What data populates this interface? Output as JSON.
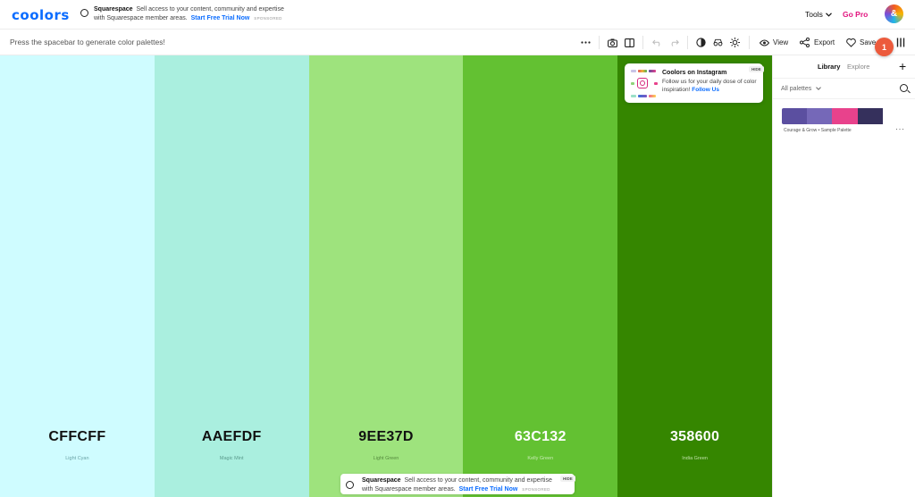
{
  "app": {
    "logo": "coolors"
  },
  "top_ad": {
    "brand": "Squarespace",
    "line1": "Sell access to your content, community and expertise",
    "line2": "with Squarespace member areas.",
    "cta": "Start Free Trial Now",
    "sponsored": "SPONSORED"
  },
  "header": {
    "tools_label": "Tools",
    "gopro_label": "Go Pro",
    "avatar_initial": "&"
  },
  "toolbar": {
    "hint": "Press the spacebar to generate color palettes!",
    "view_label": "View",
    "export_label": "Export",
    "save_label": "Save",
    "notification_count": "1"
  },
  "palette": [
    {
      "hex": "CFFCFF",
      "name": "Light Cyan",
      "bg": "#CFFCFF",
      "fg": "#111111",
      "sub": "#6aa3a6"
    },
    {
      "hex": "AAEFDF",
      "name": "Magic Mint",
      "bg": "#AAEFDF",
      "fg": "#111111",
      "sub": "#5a9a8c"
    },
    {
      "hex": "9EE37D",
      "name": "Light Green",
      "bg": "#9EE37D",
      "fg": "#111111",
      "sub": "#558a3e"
    },
    {
      "hex": "63C132",
      "name": "Kelly Green",
      "bg": "#63C132",
      "fg": "#ffffff",
      "sub": "#c9ecb6"
    },
    {
      "hex": "358600",
      "name": "India Green",
      "bg": "#358600",
      "fg": "#ffffff",
      "sub": "#bfe0a8"
    }
  ],
  "instagram": {
    "title": "Coolors on Instagram",
    "body": "Follow us for your daily dose of color inspiration!",
    "link": "Follow Us",
    "hide": "HIDE"
  },
  "bottom_ad": {
    "brand": "Squarespace",
    "line1": "Sell access to your content, community and expertise",
    "line2": "with Squarespace member areas.",
    "cta": "Start Free Trial Now",
    "sponsored": "SPONSORED",
    "hide": "HIDE"
  },
  "sidebar": {
    "tabs": [
      {
        "label": "Library",
        "active": true
      },
      {
        "label": "Explore",
        "active": false
      }
    ],
    "filter_label": "All palettes",
    "saved_palette": {
      "name": "Courage & Grow • Sample Palette",
      "colors": [
        "#5b4fa0",
        "#7568b8",
        "#e8428c",
        "#35305c",
        "#ffffff"
      ]
    }
  },
  "colors": {
    "accent": "#0a6cff",
    "gopro": "#e2137e",
    "badge": "#ec5a3c"
  }
}
